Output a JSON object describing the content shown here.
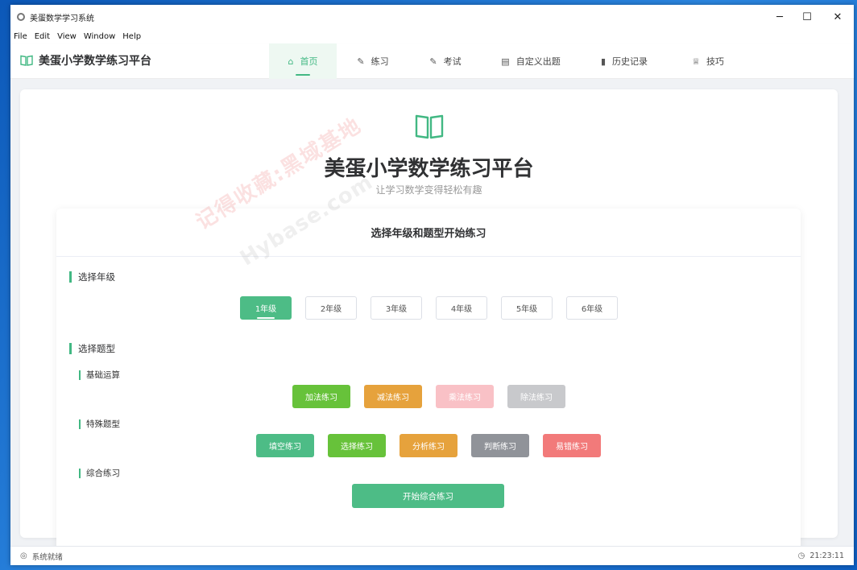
{
  "window": {
    "title": "美蛋数学学习系统",
    "minimize_icon": "─",
    "maximize_icon": "☐",
    "close_icon": "✕"
  },
  "menu": [
    "File",
    "Edit",
    "View",
    "Window",
    "Help"
  ],
  "brand": {
    "name": "美蛋小学数学练习平台"
  },
  "nav": [
    {
      "label": "首页",
      "icon": "home-icon",
      "active": true
    },
    {
      "label": "练习",
      "icon": "edit-icon"
    },
    {
      "label": "考试",
      "icon": "edit-icon"
    },
    {
      "label": "自定义出题",
      "icon": "document-icon"
    },
    {
      "label": "历史记录",
      "icon": "bar-chart-icon"
    },
    {
      "label": "技巧",
      "icon": "trophy-icon"
    }
  ],
  "hero": {
    "title": "美蛋小学数学练习平台",
    "subtitle": "让学习数学变得轻松有趣"
  },
  "watermark": {
    "text": "记得收藏:黑域基地",
    "text2": "Hybase.com"
  },
  "practice": {
    "header": "选择年级和题型开始练习",
    "grade_title": "选择年级",
    "grades": [
      "1年级",
      "2年级",
      "3年级",
      "4年级",
      "5年级",
      "6年级"
    ],
    "selected_grade": "1年级",
    "type_title": "选择题型",
    "basic_title": "基础运算",
    "basic_buttons": [
      "加法练习",
      "减法练习",
      "乘法练习",
      "除法练习"
    ],
    "special_title": "特殊题型",
    "special_buttons": [
      "填空练习",
      "选择练习",
      "分析练习",
      "判断练习",
      "易错练习"
    ],
    "combo_title": "综合练习",
    "start_button": "开始综合练习"
  },
  "status": {
    "text": "系统就绪",
    "time": "21:23:11"
  },
  "colors": {
    "accent": "#42b883",
    "green": "#67c23a",
    "orange": "#e6a23c",
    "pink": "#f9c1c6",
    "grey": "#c8c9cc",
    "dark_grey": "#909399",
    "red": "#f27a7a"
  }
}
